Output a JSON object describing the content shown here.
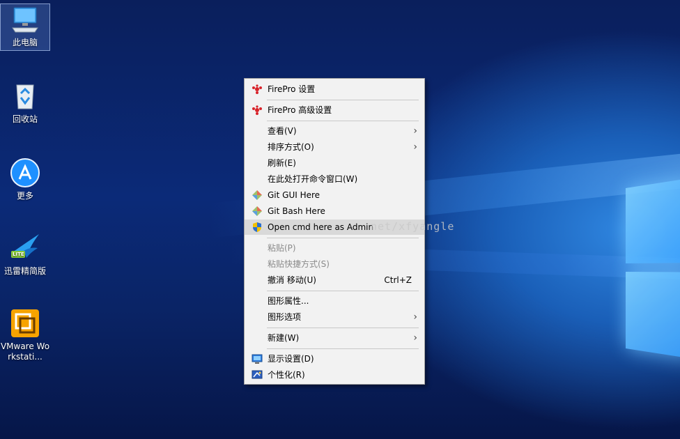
{
  "desktop": {
    "icons": [
      {
        "label": "此电脑",
        "icon": "computer-icon"
      },
      {
        "label": "回收站",
        "icon": "recycle-bin-icon"
      },
      {
        "label": "更多",
        "icon": "app-store-icon"
      },
      {
        "label": "迅雷精简版",
        "icon": "thunder-bird-icon",
        "badge": "LITE"
      },
      {
        "label": "VMware Workstati...",
        "icon": "vmware-icon"
      }
    ]
  },
  "context_menu": {
    "items": [
      {
        "label": "FirePro 设置",
        "icon": "firepro-icon"
      },
      {
        "label": "FirePro 高级设置",
        "icon": "firepro-icon"
      },
      {
        "label": "查看(V)",
        "submenu": "›"
      },
      {
        "label": "排序方式(O)",
        "submenu": "›"
      },
      {
        "label": "刷新(E)"
      },
      {
        "label": "在此处打开命令窗口(W)"
      },
      {
        "label": "Git GUI Here",
        "icon": "git-icon"
      },
      {
        "label": "Git Bash Here",
        "icon": "git-icon"
      },
      {
        "label": "Open cmd here as Admin",
        "icon": "uac-shield-icon"
      },
      {
        "label": "粘贴(P)",
        "disabled": true
      },
      {
        "label": "粘贴快捷方式(S)",
        "disabled": true
      },
      {
        "label": "撤消 移动(U)",
        "shortcut": "Ctrl+Z"
      },
      {
        "label": "图形属性..."
      },
      {
        "label": "图形选项",
        "submenu": "›"
      },
      {
        "label": "新建(W)",
        "submenu": "›"
      },
      {
        "label": "显示设置(D)",
        "icon": "display-icon"
      },
      {
        "label": "个性化(R)",
        "icon": "personalize-icon"
      }
    ]
  },
  "watermark": "net/xfyangle",
  "colors": {
    "menu_bg": "#f2f2f2",
    "firepro_red": "#d8232a",
    "desktop_blue": "#0b2a78"
  }
}
